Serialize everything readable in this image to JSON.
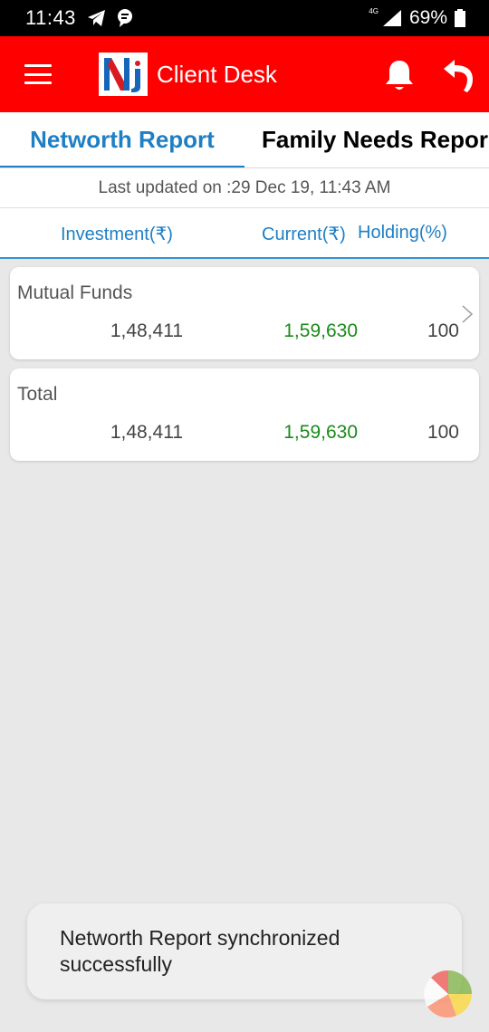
{
  "status_bar": {
    "time": "11:43",
    "network": "4G",
    "battery": "69%"
  },
  "app_bar": {
    "title": "Client Desk",
    "brand_color": "#ff0000"
  },
  "tabs": [
    {
      "label": "Networth Report",
      "active": true
    },
    {
      "label": "Family Needs Repor",
      "active": false
    }
  ],
  "last_updated": "Last updated on :29 Dec 19, 11:43 AM",
  "columns": {
    "investment": "Investment(₹)",
    "current": "Current(₹)",
    "holding": "Holding(%)"
  },
  "rows": [
    {
      "title": "Mutual Funds",
      "investment": "1,48,411",
      "current": "1,59,630",
      "holding": "100"
    },
    {
      "title": "Total",
      "investment": "1,48,411",
      "current": "1,59,630",
      "holding": "100"
    }
  ],
  "toast": {
    "message": "Networth Report synchronized successfully"
  },
  "colors": {
    "accent": "#1e7fc4",
    "positive": "#1a8a1a"
  }
}
